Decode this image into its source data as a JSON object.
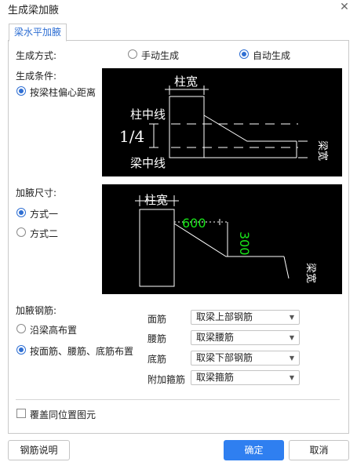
{
  "window": {
    "title": "生成梁加腋"
  },
  "tab": {
    "label": "梁水平加腋"
  },
  "gen_method": {
    "label": "生成方式:",
    "options": [
      "手动生成",
      "自动生成"
    ],
    "selected": "自动生成"
  },
  "gen_condition": {
    "label": "生成条件:",
    "option": "按梁柱偏心距离"
  },
  "diagram1": {
    "column_width": "柱宽",
    "column_center_line": "柱中线",
    "beam_center_line": "梁中线",
    "ratio": "1/4",
    "beam_width": "梁宽"
  },
  "haunch_size": {
    "label": "加腋尺寸:",
    "options": [
      "方式一",
      "方式二"
    ],
    "selected": "方式一"
  },
  "diagram2": {
    "column_width": "柱宽",
    "dim_600": "600",
    "dim_300": "300",
    "beam_width": "梁宽"
  },
  "haunch_rebar": {
    "label": "加腋钢筋:",
    "options": [
      "沿梁高布置",
      "按面筋、腰筋、底筋布置"
    ],
    "selected": "按面筋、腰筋、底筋布置",
    "fields": [
      {
        "label": "面筋",
        "value": "取梁上部钢筋"
      },
      {
        "label": "腰筋",
        "value": "取梁腰筋"
      },
      {
        "label": "底筋",
        "value": "取梁下部钢筋"
      },
      {
        "label": "附加箍筋",
        "value": "取梁箍筋"
      }
    ]
  },
  "overwrite": {
    "label": "覆盖同位置图元",
    "checked": false
  },
  "buttons": {
    "rebar_help": "钢筋说明",
    "ok": "确定",
    "cancel": "取消"
  },
  "colors": {
    "accent": "#2f7ff0",
    "dimension_green": "#19e319"
  }
}
